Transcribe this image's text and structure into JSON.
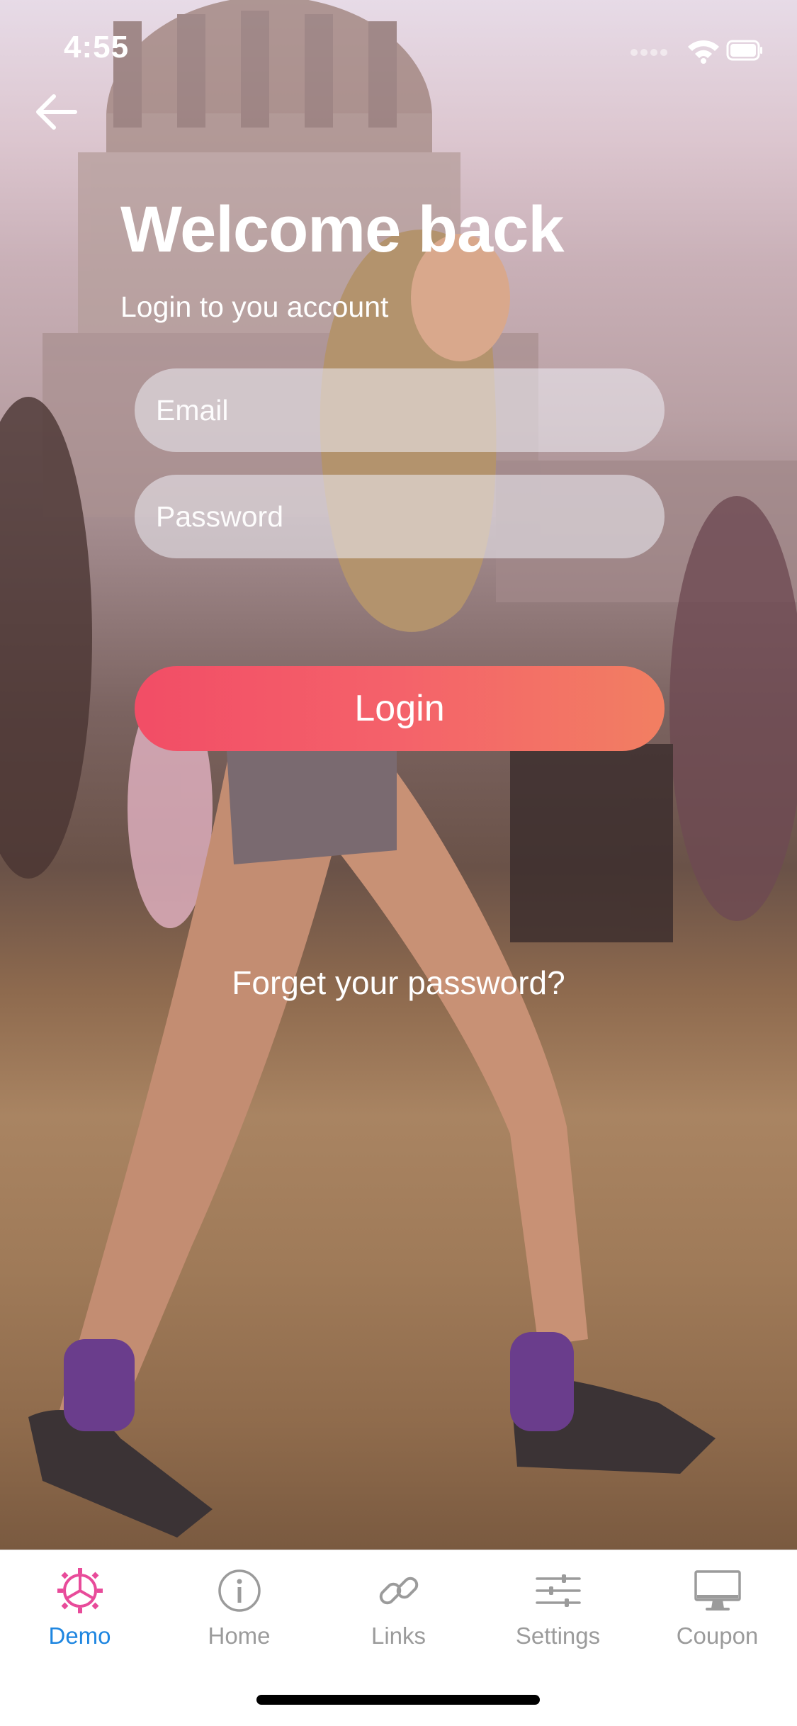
{
  "status_bar": {
    "time": "4:55",
    "icons": [
      "signal-dots-icon",
      "wifi-icon",
      "battery-icon"
    ]
  },
  "header": {
    "back_icon": "arrow-left-icon"
  },
  "login": {
    "title": "Welcome back",
    "subtitle": "Login to you account",
    "email_placeholder": "Email",
    "password_placeholder": "Password",
    "login_label": "Login",
    "forgot_label": "Forget your password?"
  },
  "colors": {
    "login_gradient_start": "#f24d66",
    "login_gradient_end": "#f27f62",
    "tab_active": "#1f86e0",
    "tab_active_icon": "#e84b9a",
    "tab_inactive": "#9b9b9b"
  },
  "tabbar": {
    "items": [
      {
        "label": "Demo",
        "icon": "gear-pie-icon",
        "active": true
      },
      {
        "label": "Home",
        "icon": "info-circle-icon",
        "active": false
      },
      {
        "label": "Links",
        "icon": "link-icon",
        "active": false
      },
      {
        "label": "Settings",
        "icon": "sliders-icon",
        "active": false
      },
      {
        "label": "Coupon",
        "icon": "monitor-icon",
        "active": false
      }
    ]
  }
}
